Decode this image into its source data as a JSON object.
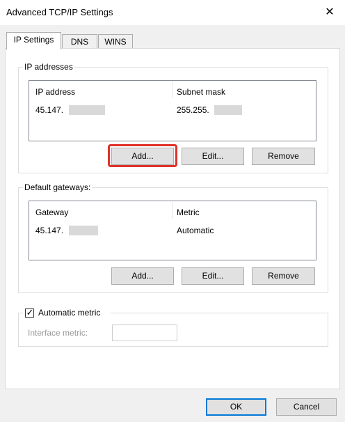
{
  "window": {
    "title": "Advanced TCP/IP Settings",
    "close_glyph": "✕"
  },
  "tabs": [
    {
      "label": "IP Settings"
    },
    {
      "label": "DNS"
    },
    {
      "label": "WINS"
    }
  ],
  "ip_addresses": {
    "legend": "IP addresses",
    "columns": [
      "IP address",
      "Subnet mask"
    ],
    "rows": [
      {
        "ip": "45.147.",
        "mask": "255.255."
      }
    ],
    "buttons": {
      "add": "Add...",
      "edit": "Edit...",
      "remove": "Remove"
    }
  },
  "gateways": {
    "legend": "Default gateways:",
    "columns": [
      "Gateway",
      "Metric"
    ],
    "rows": [
      {
        "gateway": "45.147.",
        "metric": "Automatic"
      }
    ],
    "buttons": {
      "add": "Add...",
      "edit": "Edit...",
      "remove": "Remove"
    }
  },
  "metric": {
    "automatic_label": "Automatic metric",
    "checked": true,
    "check_glyph": "✓",
    "interface_label": "Interface metric:",
    "interface_value": ""
  },
  "footer": {
    "ok": "OK",
    "cancel": "Cancel"
  },
  "colors": {
    "highlight": "#e0312b",
    "accent": "#0078d7"
  }
}
